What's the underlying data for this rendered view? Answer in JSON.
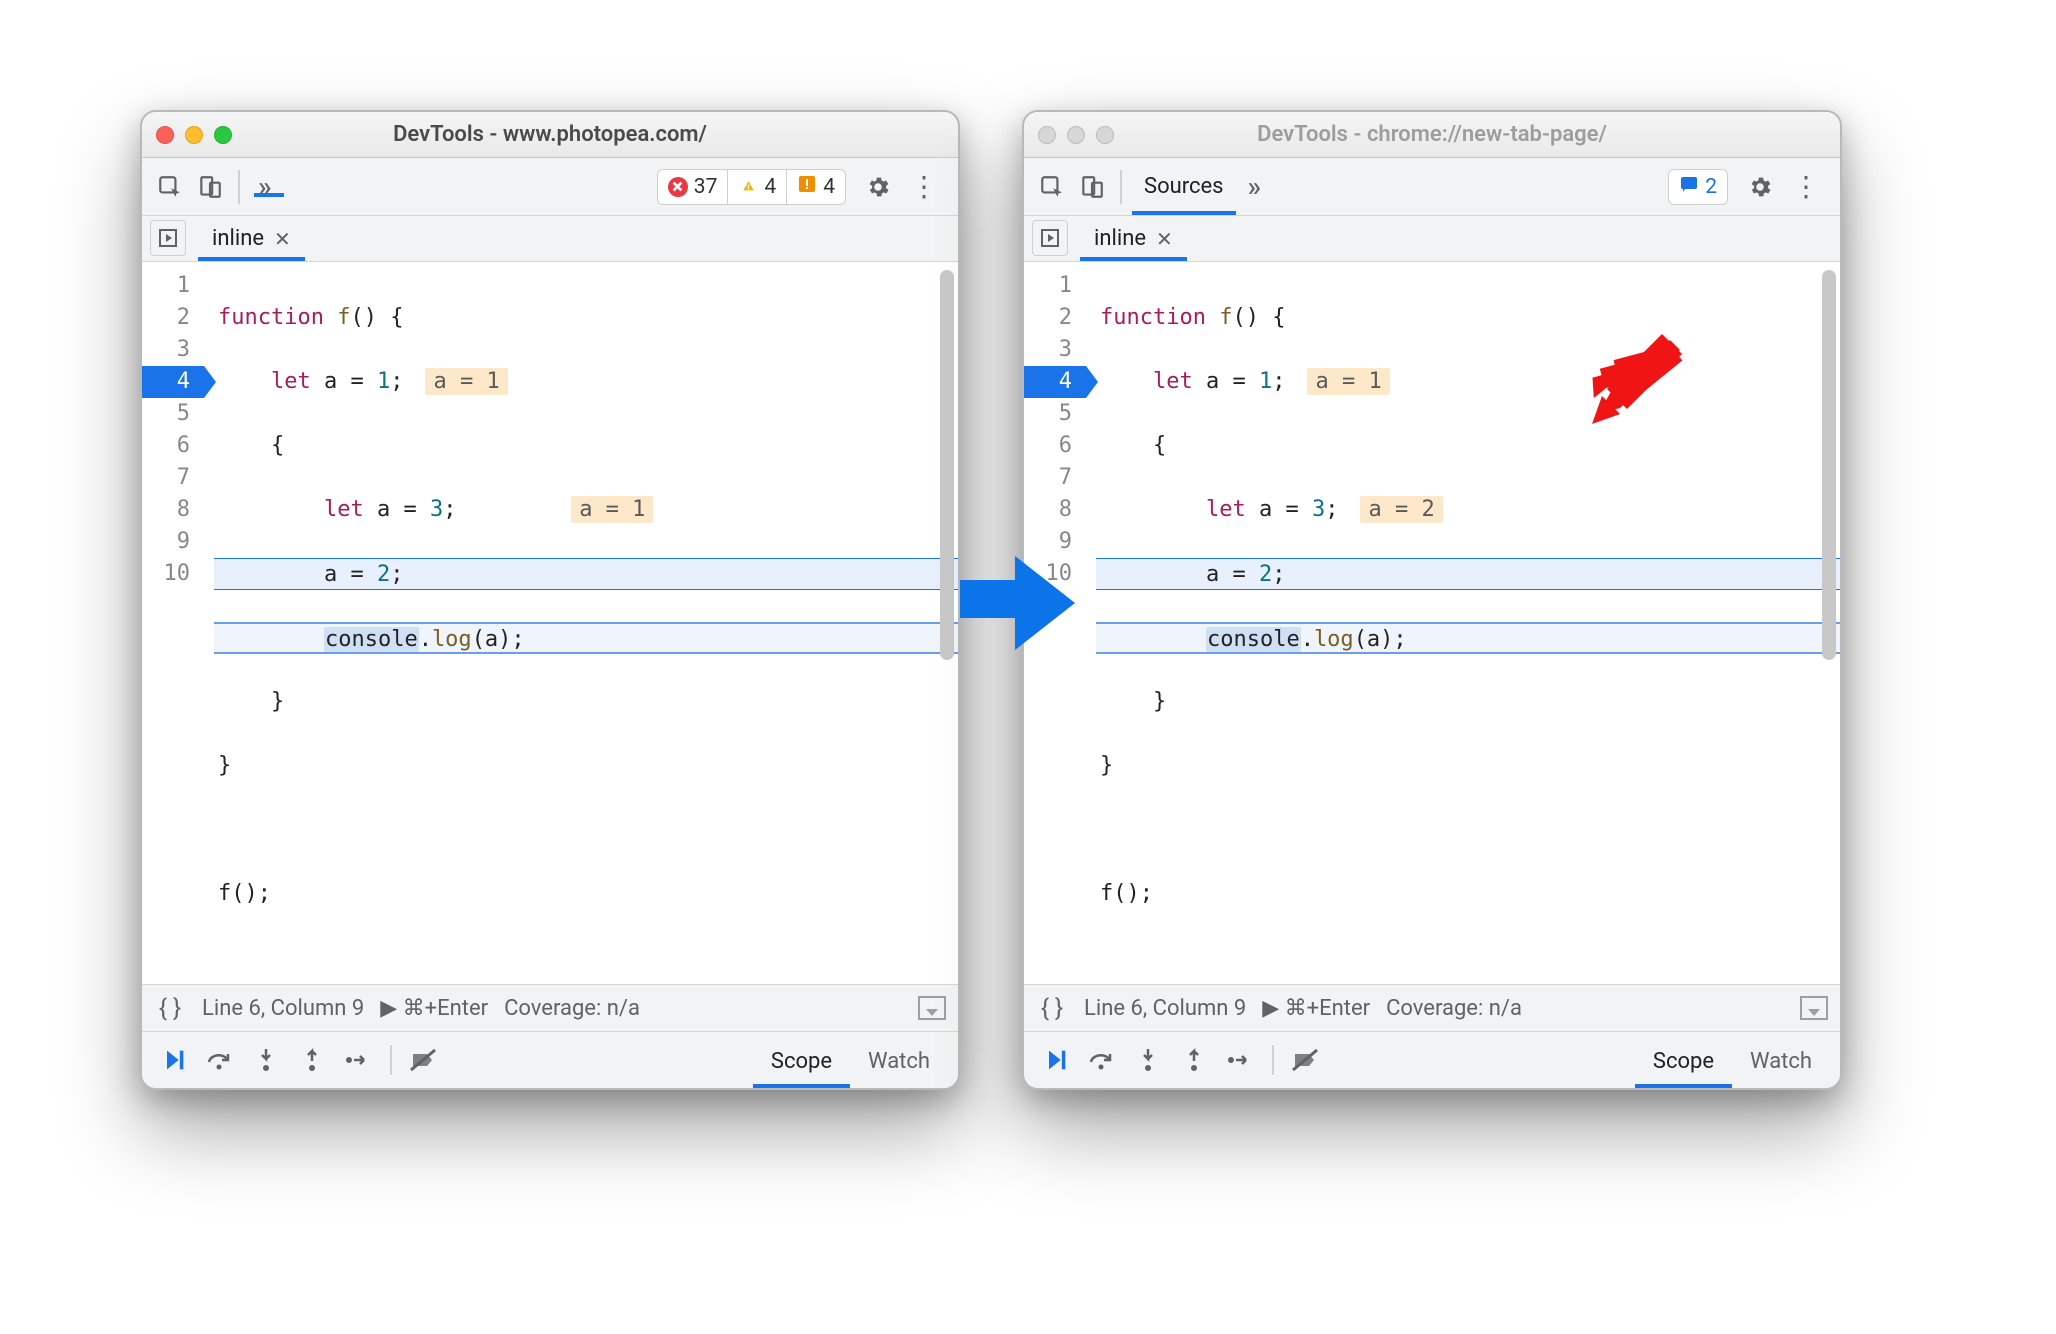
{
  "left": {
    "title": "DevTools - www.photopea.com/",
    "badges": {
      "errors": "37",
      "warnings": "4",
      "issues": "4"
    },
    "file_tab": "inline",
    "code": {
      "l1a": "function",
      "l1b": " f",
      "l1c": "() {",
      "l2a": "let",
      "l2b": " a ",
      "l2c": "= ",
      "l2d": "1",
      "l2e": ";",
      "l2hint": "a = 1",
      "l3": "{",
      "l4a": "let",
      "l4b": " a ",
      "l4c": "= ",
      "l4d": "3",
      "l4e": ";",
      "l4hint": "a = 1",
      "l5a": "a ",
      "l5b": "= ",
      "l5c": "2",
      "l5d": ";",
      "l6a": "console",
      "l6b": ".",
      "l6c": "log",
      "l6d": "(a);",
      "l7": "}",
      "l8": "}",
      "l10": "f();"
    },
    "status": {
      "pos": "Line 6, Column 9",
      "exec": "▶ ⌘+Enter",
      "cov": "Coverage: n/a"
    },
    "scope_tab": "Scope",
    "watch_tab": "Watch"
  },
  "right": {
    "title": "DevTools - chrome://new-tab-page/",
    "sources_tab": "Sources",
    "badge_msgs": "2",
    "file_tab": "inline",
    "code": {
      "l1a": "function",
      "l1b": " f",
      "l1c": "() {",
      "l2a": "let",
      "l2b": " a ",
      "l2c": "= ",
      "l2d": "1",
      "l2e": ";",
      "l2hint": "a = 1",
      "l3": "{",
      "l4a": "let",
      "l4b": " a ",
      "l4c": "= ",
      "l4d": "3",
      "l4e": ";",
      "l4hint": "a = 2",
      "l5a": "a ",
      "l5b": "= ",
      "l5c": "2",
      "l5d": ";",
      "l6a": "console",
      "l6b": ".",
      "l6c": "log",
      "l6d": "(a);",
      "l7": "}",
      "l8": "}",
      "l10": "f();"
    },
    "status": {
      "pos": "Line 6, Column 9",
      "exec": "▶ ⌘+Enter",
      "cov": "Coverage: n/a"
    },
    "scope_tab": "Scope",
    "watch_tab": "Watch"
  },
  "line_numbers": [
    "1",
    "2",
    "3",
    "4",
    "5",
    "6",
    "7",
    "8",
    "9",
    "10"
  ]
}
